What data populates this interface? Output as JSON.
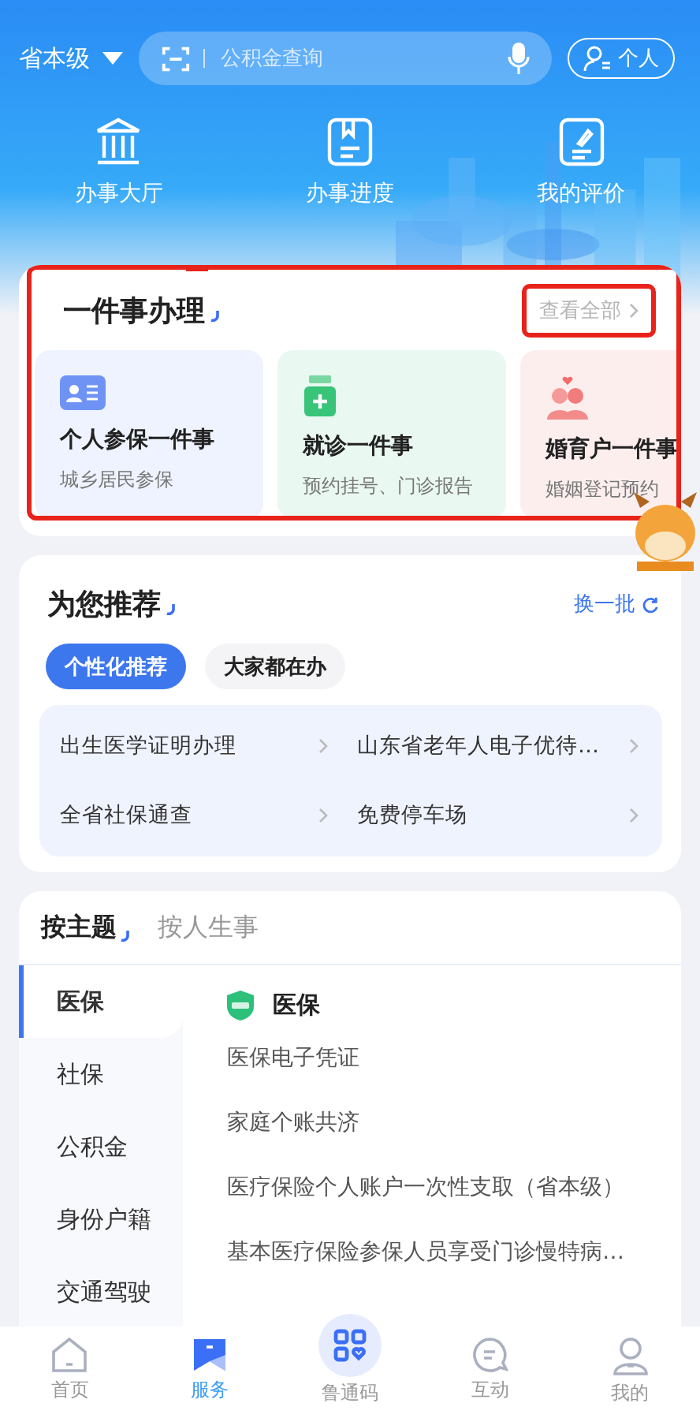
{
  "location": {
    "label": "省本级"
  },
  "search": {
    "placeholder": "公积金查询"
  },
  "identity_button": {
    "label": "个人"
  },
  "quick_links": [
    {
      "label": "办事大厅"
    },
    {
      "label": "办事进度"
    },
    {
      "label": "我的评价"
    }
  ],
  "one_thing": {
    "title": "一件事办理",
    "more": "查看全部",
    "cards": [
      {
        "kind": "insurance",
        "title": "个人参保一件事",
        "subtitle": "城乡居民参保"
      },
      {
        "kind": "medical",
        "title": "就诊一件事",
        "subtitle": "预约挂号、门诊报告"
      },
      {
        "kind": "marriage",
        "title": "婚育户一件事",
        "subtitle": "婚姻登记预约"
      }
    ]
  },
  "recommend": {
    "title": "为您推荐",
    "refresh": "换一批",
    "chips": [
      {
        "label": "个性化推荐",
        "selected": true
      },
      {
        "label": "大家都在办",
        "selected": false
      }
    ],
    "items": [
      "出生医学证明办理",
      "山东省老年人电子优待…",
      "全省社保通查",
      "免费停车场"
    ]
  },
  "topics": {
    "tabs": [
      {
        "label": "按主题",
        "selected": true
      },
      {
        "label": "按人生事",
        "selected": false
      }
    ],
    "categories": [
      {
        "label": "医保",
        "selected": true
      },
      {
        "label": "社保",
        "selected": false
      },
      {
        "label": "公积金",
        "selected": false
      },
      {
        "label": "身份户籍",
        "selected": false
      },
      {
        "label": "交通驾驶",
        "selected": false
      }
    ],
    "section_title": "医保",
    "items": [
      "医保电子凭证",
      "家庭个账共济",
      "医疗保险个人账户一次性支取（省本级）",
      "基本医疗保险参保人员享受门诊慢特病…"
    ]
  },
  "tab_bar": [
    {
      "label": "首页",
      "selected": false,
      "kind": "normal"
    },
    {
      "label": "服务",
      "selected": true,
      "kind": "normal"
    },
    {
      "label": "鲁通码",
      "selected": false,
      "kind": "raised"
    },
    {
      "label": "互动",
      "selected": false,
      "kind": "normal"
    },
    {
      "label": "我的",
      "selected": false,
      "kind": "normal"
    }
  ]
}
